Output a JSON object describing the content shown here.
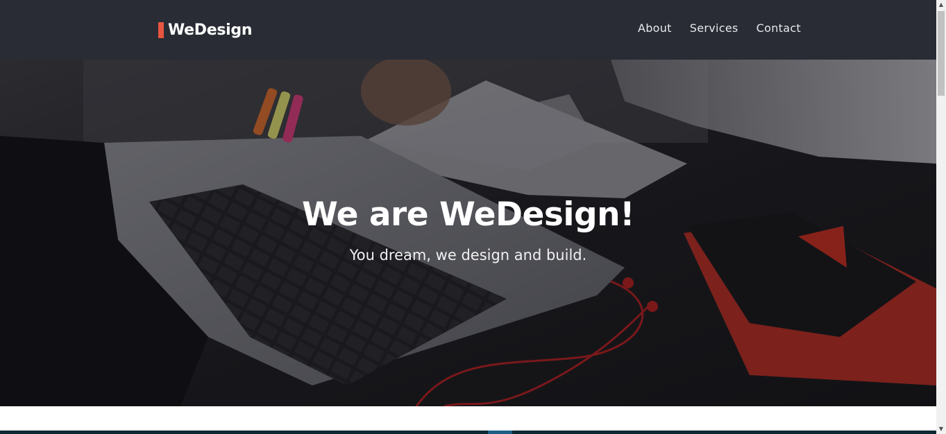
{
  "header": {
    "logo_text": "WeDesign",
    "nav": [
      {
        "label": "About"
      },
      {
        "label": "Services"
      },
      {
        "label": "Contact"
      }
    ]
  },
  "hero": {
    "title": "We are WeDesign!",
    "subtitle": "You dream, we design and build.",
    "image": "laptop-desk-photo"
  },
  "colors": {
    "header_bg": "#292c35",
    "accent": "#e8553f",
    "bottom_strip": "#0f2633"
  }
}
